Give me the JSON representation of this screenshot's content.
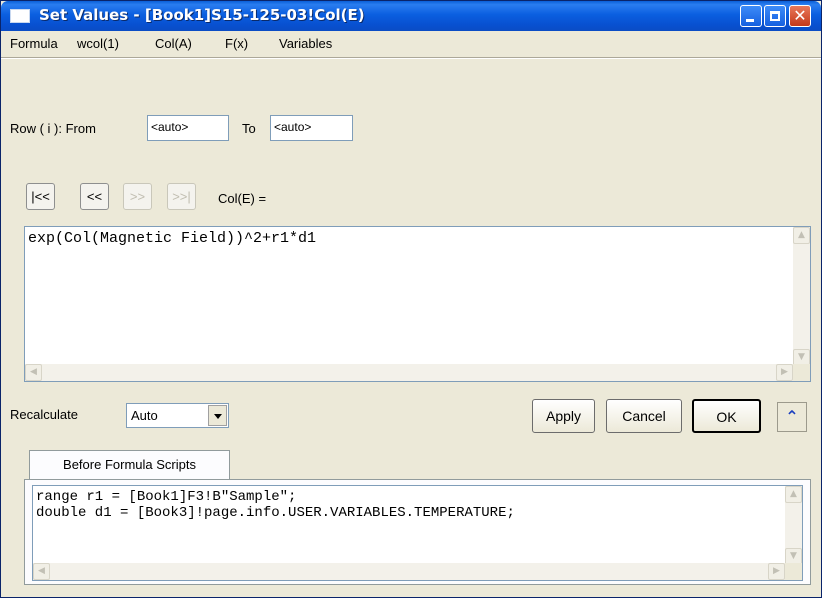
{
  "window": {
    "title": "Set Values - [Book1]S15-125-03!Col(E)"
  },
  "menu": {
    "items": [
      "Formula",
      "wcol(1)",
      "Col(A)",
      "F(x)",
      "Variables"
    ]
  },
  "row_range": {
    "label": "Row ( i ):  From",
    "from_value": "<auto>",
    "to_label": "To",
    "to_value": "<auto>"
  },
  "nav": {
    "first": "|<<",
    "prev": "<<",
    "next": ">>",
    "last": ">>|",
    "target_label": "Col(E) ="
  },
  "formula": {
    "text": "exp(Col(Magnetic Field))^2+r1*d1"
  },
  "recalculate": {
    "label": "Recalculate",
    "value": "Auto"
  },
  "buttons": {
    "apply": "Apply",
    "cancel": "Cancel",
    "ok": "OK",
    "expand": "⌃"
  },
  "tabs": {
    "before_formula": "Before Formula Scripts"
  },
  "script": {
    "text": "range r1 = [Book1]F3!B\"Sample\";\ndouble d1 = [Book3]!page.info.USER.VARIABLES.TEMPERATURE;"
  },
  "colors": {
    "titlebar": "#0a5fd8",
    "window_bg": "#ece9d8",
    "close_button": "#c5391a"
  }
}
